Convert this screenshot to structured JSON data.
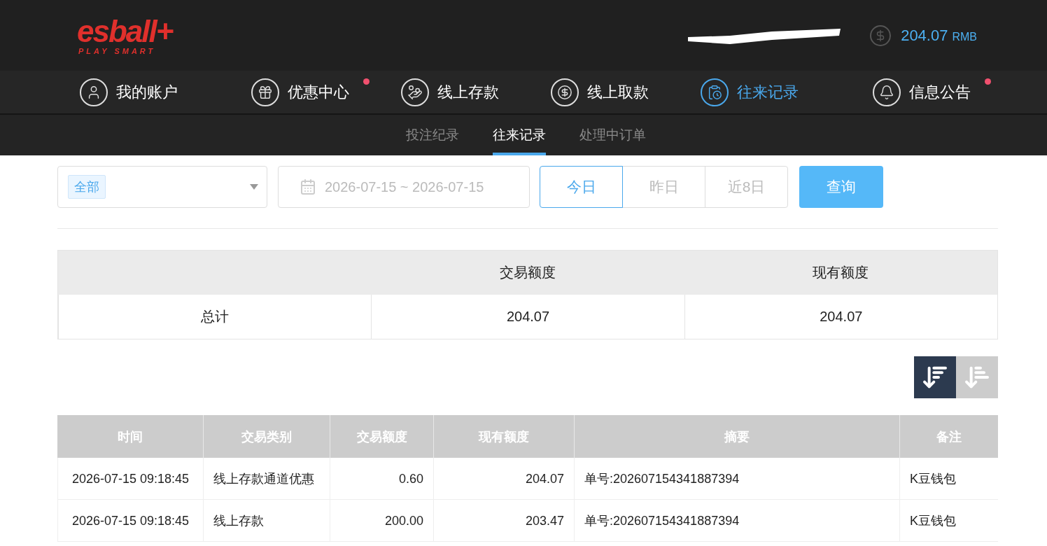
{
  "header": {
    "logo": {
      "brand": "esball+",
      "tagline": "PLAY SMART"
    },
    "balance": {
      "amount": "204.07",
      "currency": "RMB"
    }
  },
  "nav": [
    {
      "label": "我的账户",
      "kind": "user",
      "selected": false,
      "badge": false
    },
    {
      "label": "优惠中心",
      "kind": "gift",
      "selected": false,
      "badge": true
    },
    {
      "label": "线上存款",
      "kind": "deposit",
      "selected": false,
      "badge": false
    },
    {
      "label": "线上取款",
      "kind": "withdraw",
      "selected": false,
      "badge": false
    },
    {
      "label": "往来记录",
      "kind": "records",
      "selected": true,
      "badge": false
    },
    {
      "label": "信息公告",
      "kind": "bell",
      "selected": false,
      "badge": true
    }
  ],
  "subtabs": [
    {
      "label": "投注纪录",
      "selected": false
    },
    {
      "label": "往来记录",
      "selected": true
    },
    {
      "label": "处理中订单",
      "selected": false
    }
  ],
  "filters": {
    "category": {
      "value": "全部"
    },
    "date_range": {
      "value": "2026-07-15 ~ 2026-07-15"
    },
    "quick_ranges": [
      {
        "label": "今日",
        "selected": true
      },
      {
        "label": "昨日",
        "selected": false
      },
      {
        "label": "近8日",
        "selected": false
      }
    ],
    "search_button": "查询"
  },
  "summary": {
    "columns": [
      "交易额度",
      "现有额度"
    ],
    "row": {
      "label": "总计",
      "values": [
        "204.07",
        "204.07"
      ]
    }
  },
  "sort_buttons": [
    {
      "kind": "desc",
      "selected": true
    },
    {
      "kind": "asc",
      "selected": false
    }
  ],
  "table": {
    "columns": [
      "时间",
      "交易类别",
      "交易额度",
      "现有额度",
      "摘要",
      "备注"
    ],
    "rows": [
      [
        "2026-07-15 09:18:45",
        "线上存款通道优惠",
        "0.60",
        "204.07",
        "单号:202607154341887394",
        "K豆钱包"
      ],
      [
        "2026-07-15 09:18:45",
        "线上存款",
        "200.00",
        "203.47",
        "单号:202607154341887394",
        "K豆钱包"
      ]
    ]
  }
}
